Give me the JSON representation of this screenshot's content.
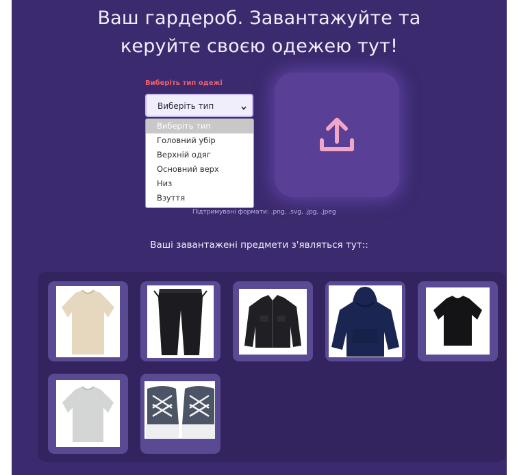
{
  "page": {
    "title_line1": "Ваш гардероб. Завантажуйте та",
    "title_line2": "керуйте своєю одежею тут!"
  },
  "clothing_type": {
    "label": "Виберіть тип одежі",
    "selected": "Виберіть тип",
    "options": [
      "Виберіть тип",
      "Головний убір",
      "Верхній одяг",
      "Основний верх",
      "Низ",
      "Взуття"
    ]
  },
  "upload": {
    "icon": "upload-icon",
    "formats": "Підтримувані формати: .png, .svg, .jpg, .jpeg"
  },
  "gallery": {
    "heading": "Ваші завантажені предмети з'являться тут::",
    "items": [
      {
        "type": "beige-tshirt"
      },
      {
        "type": "black-cargo-pants"
      },
      {
        "type": "black-jacket"
      },
      {
        "type": "navy-hoodie"
      },
      {
        "type": "black-tshirt"
      },
      {
        "type": "gray-tshirt"
      },
      {
        "type": "sneakers"
      }
    ]
  },
  "colors": {
    "background": "#3b2a6e",
    "upload_card": "#5a3f97",
    "accent_label": "#f0606e",
    "upload_icon": "#f2a7c8"
  }
}
